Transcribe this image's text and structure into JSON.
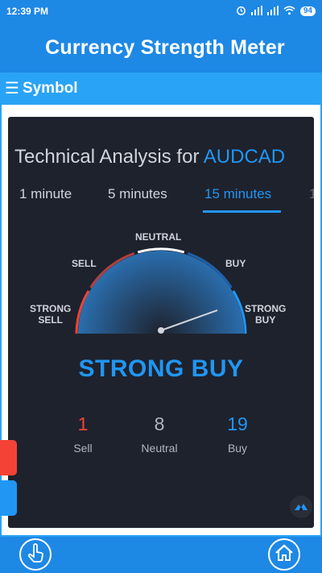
{
  "status_bar": {
    "time": "12:39 PM",
    "battery": "94"
  },
  "app": {
    "title": "Currency Strength Meter"
  },
  "symbol_bar": {
    "menu_icon": "☰",
    "label": "Symbol"
  },
  "widget": {
    "title_prefix": "Technical Analysis for ",
    "symbol": "AUDCAD",
    "tabs": [
      {
        "label": "1 minute",
        "active": false
      },
      {
        "label": "5 minutes",
        "active": false
      },
      {
        "label": "15 minutes",
        "active": true
      }
    ],
    "gauge_labels": {
      "strong_sell_1": "STRONG",
      "strong_sell_2": "SELL",
      "sell": "SELL",
      "neutral": "NEUTRAL",
      "buy": "BUY",
      "strong_buy_1": "STRONG",
      "strong_buy_2": "BUY"
    },
    "verdict": "STRONG BUY",
    "counts": {
      "sell": {
        "value": "1",
        "label": "Sell"
      },
      "neutral": {
        "value": "8",
        "label": "Neutral"
      },
      "buy": {
        "value": "19",
        "label": "Buy"
      }
    }
  },
  "colors": {
    "primary": "#1e88e5",
    "accent": "#2196f3",
    "sell": "#f44336",
    "neutral": "#d1d4dc",
    "widget_bg": "#1e222d"
  },
  "icons": {
    "touch": "hand-pointer-icon",
    "home": "home-icon"
  }
}
